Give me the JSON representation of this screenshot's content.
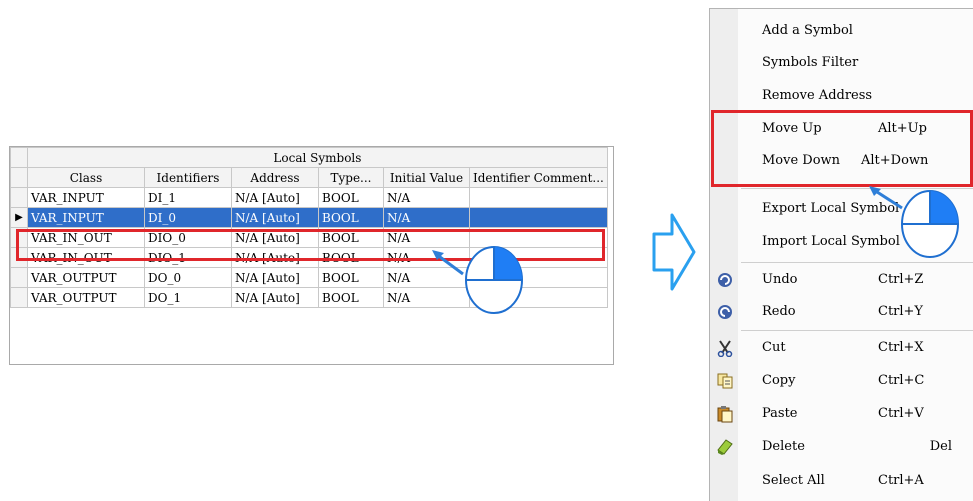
{
  "table": {
    "title": "Local Symbols",
    "columns": [
      "Class",
      "Identifiers",
      "Address",
      "Type...",
      "Initial Value",
      "Identifier Comment..."
    ],
    "rows": [
      {
        "class": "VAR_INPUT",
        "identifier": "DI_1",
        "address": "N/A [Auto]",
        "type": "BOOL",
        "initial": "N/A",
        "comment": ""
      },
      {
        "class": "VAR_INPUT",
        "identifier": "DI_0",
        "address": "N/A [Auto]",
        "type": "BOOL",
        "initial": "N/A",
        "comment": ""
      },
      {
        "class": "VAR_IN_OUT",
        "identifier": "DIO_0",
        "address": "N/A [Auto]",
        "type": "BOOL",
        "initial": "N/A",
        "comment": ""
      },
      {
        "class": "VAR_IN_OUT",
        "identifier": "DIO_1",
        "address": "N/A [Auto]",
        "type": "BOOL",
        "initial": "N/A",
        "comment": ""
      },
      {
        "class": "VAR_OUTPUT",
        "identifier": "DO_0",
        "address": "N/A [Auto]",
        "type": "BOOL",
        "initial": "N/A",
        "comment": ""
      },
      {
        "class": "VAR_OUTPUT",
        "identifier": "DO_1",
        "address": "N/A [Auto]",
        "type": "BOOL",
        "initial": "N/A",
        "comment": ""
      }
    ],
    "row_indicator": "▶"
  },
  "menu": {
    "add_symbol": "Add a Symbol",
    "symbols_filter": "Symbols Filter",
    "remove_address": "Remove Address",
    "move_up": {
      "label": "Move Up",
      "shortcut": "Alt+Up"
    },
    "move_down": {
      "label": "Move Down",
      "shortcut": "Alt+Down"
    },
    "export_local": "Export Local Symbol",
    "import_local": "Import Local Symbol",
    "undo": {
      "label": "Undo",
      "shortcut": "Ctrl+Z",
      "icon": "undo-icon"
    },
    "redo": {
      "label": "Redo",
      "shortcut": "Ctrl+Y",
      "icon": "redo-icon"
    },
    "cut": {
      "label": "Cut",
      "shortcut": "Ctrl+X",
      "icon": "scissors-icon"
    },
    "copy": {
      "label": "Copy",
      "shortcut": "Ctrl+C",
      "icon": "copy-icon"
    },
    "paste": {
      "label": "Paste",
      "shortcut": "Ctrl+V",
      "icon": "paste-icon"
    },
    "delete": {
      "label": "Delete",
      "shortcut": "Del",
      "icon": "eraser-icon"
    },
    "select_all": {
      "label": "Select All",
      "shortcut": "Ctrl+A"
    }
  },
  "colors": {
    "selection": "#2f6ec9",
    "highlight_box": "#e0262b",
    "arrow_fill": "#ffffff",
    "arrow_stroke": "#2aa0ef",
    "mouse_fill": "#1f7ef5"
  }
}
